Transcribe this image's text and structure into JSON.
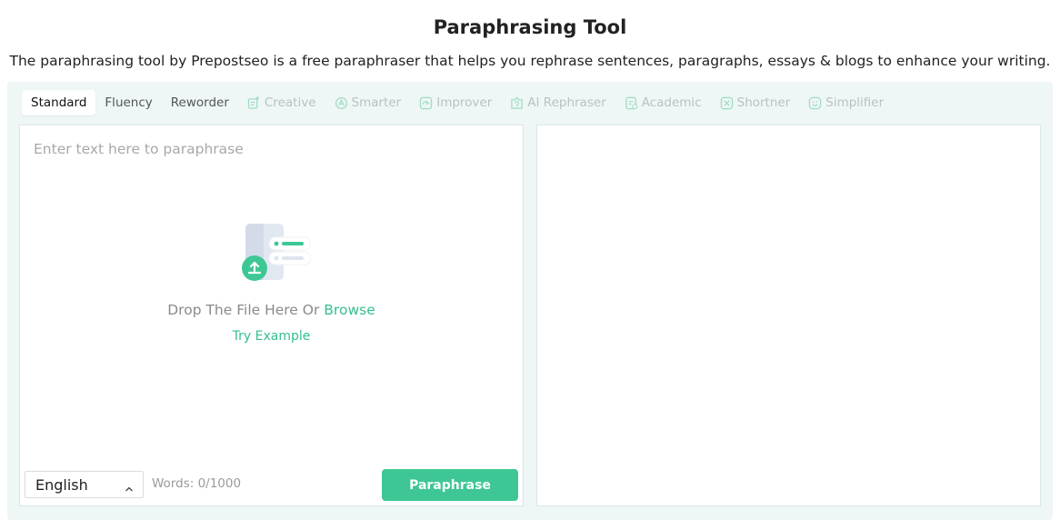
{
  "header": {
    "title": "Paraphrasing Tool",
    "subtitle": "The paraphrasing tool by Prepostseo is a free paraphraser that helps you rephrase sentences, paragraphs, essays & blogs to enhance your writing."
  },
  "tabs": [
    {
      "label": "Standard",
      "active": true,
      "locked": false,
      "icon": ""
    },
    {
      "label": "Fluency",
      "active": false,
      "locked": false,
      "icon": ""
    },
    {
      "label": "Reworder",
      "active": false,
      "locked": false,
      "icon": ""
    },
    {
      "label": "Creative",
      "active": false,
      "locked": true,
      "icon": "creative-icon"
    },
    {
      "label": "Smarter",
      "active": false,
      "locked": true,
      "icon": "smarter-icon"
    },
    {
      "label": "Improver",
      "active": false,
      "locked": true,
      "icon": "improver-icon"
    },
    {
      "label": "AI Rephraser",
      "active": false,
      "locked": true,
      "icon": "ai-rephraser-icon"
    },
    {
      "label": "Academic",
      "active": false,
      "locked": true,
      "icon": "academic-icon"
    },
    {
      "label": "Shortner",
      "active": false,
      "locked": true,
      "icon": "shortner-icon"
    },
    {
      "label": "Simplifier",
      "active": false,
      "locked": true,
      "icon": "simplifier-icon"
    }
  ],
  "input": {
    "placeholder": "Enter text here to paraphrase",
    "drop_text": "Drop The File Here Or",
    "browse_label": "Browse",
    "try_example_label": "Try Example",
    "upload_icon": "file-upload-icon"
  },
  "footer": {
    "language": "English",
    "words_count": "Words: 0/1000",
    "paraphrase_label": "Paraphrase"
  },
  "colors": {
    "accent": "#3ec794",
    "tool_background": "#eef6f6",
    "locked_tab": "#b9c2c2"
  }
}
